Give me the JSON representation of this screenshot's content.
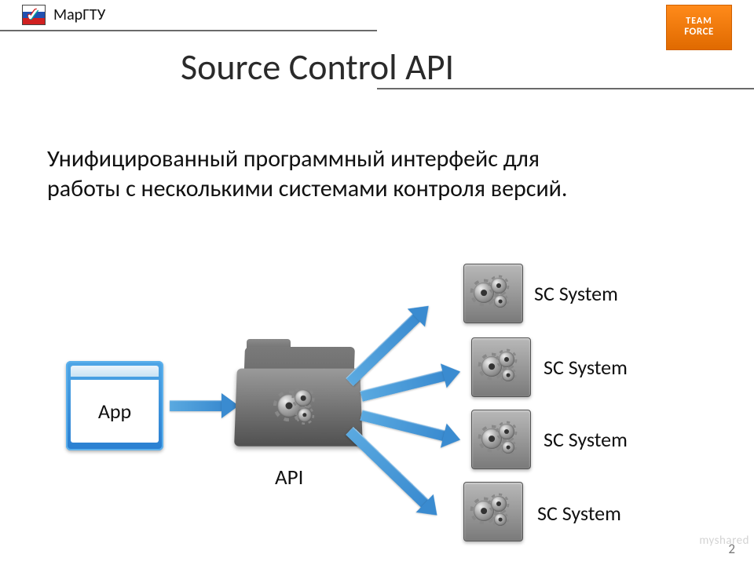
{
  "header": {
    "university": "МарГТУ",
    "title": "Source Control API",
    "right_logo": {
      "line1": "TEAM",
      "line2": "FORCE"
    }
  },
  "body": {
    "paragraph": "Унифицированный программный интерфейс для работы с несколькими системами контроля версий."
  },
  "diagram": {
    "app_label": "App",
    "api_label": "API",
    "sc_systems": [
      {
        "label": "SC System"
      },
      {
        "label": "SC System"
      },
      {
        "label": "SC System"
      },
      {
        "label": "SC System"
      }
    ]
  },
  "footer": {
    "slide_number": "2",
    "watermark": "myshared"
  }
}
